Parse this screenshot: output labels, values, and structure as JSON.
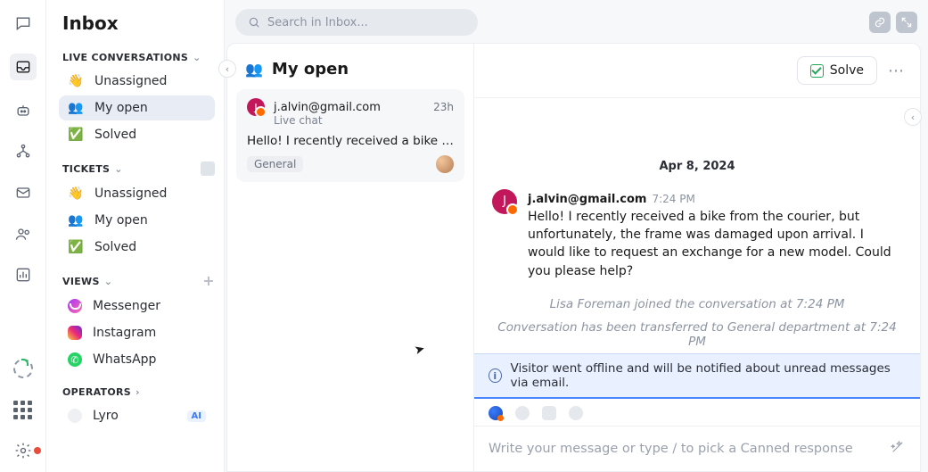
{
  "header": {
    "title": "Inbox",
    "search_placeholder": "Search in Inbox..."
  },
  "sidebar": {
    "live_header": "LIVE CONVERSATIONS",
    "live": [
      {
        "icon": "👋",
        "label": "Unassigned"
      },
      {
        "icon": "👥",
        "label": "My open"
      },
      {
        "icon": "✅",
        "label": "Solved"
      }
    ],
    "tickets_header": "TICKETS",
    "tickets": [
      {
        "icon": "👋",
        "label": "Unassigned"
      },
      {
        "icon": "👥",
        "label": "My open"
      },
      {
        "icon": "✅",
        "label": "Solved"
      }
    ],
    "views_header": "VIEWS",
    "views": [
      {
        "label": "Messenger"
      },
      {
        "label": "Instagram"
      },
      {
        "label": "WhatsApp"
      }
    ],
    "operators_header": "OPERATORS",
    "operators": [
      {
        "label": "Lyro",
        "badge": "AI"
      }
    ]
  },
  "list": {
    "title": "My open",
    "icon": "👥",
    "items": [
      {
        "initial": "J",
        "from": "j.alvin@gmail.com",
        "time": "23h",
        "source": "Live chat",
        "preview": "Hello! I recently received a bike fro…",
        "tag": "General"
      }
    ]
  },
  "conversation": {
    "solve_label": "Solve",
    "date": "Apr 8, 2024",
    "message": {
      "initial": "J",
      "from": "j.alvin@gmail.com",
      "time": "7:24 PM",
      "body": "Hello! I recently received a bike from the courier, but unfortunately, the frame was damaged upon arrival. I would like to request an exchange for a new model. Could you please help?"
    },
    "system1": "Lisa Foreman joined the conversation at 7:24 PM",
    "system2": "Conversation has been transferred to General department at 7:24 PM",
    "banner": "Visitor went offline and will be notified about unread messages via email.",
    "composer_placeholder": "Write your message or type / to pick a Canned response"
  }
}
